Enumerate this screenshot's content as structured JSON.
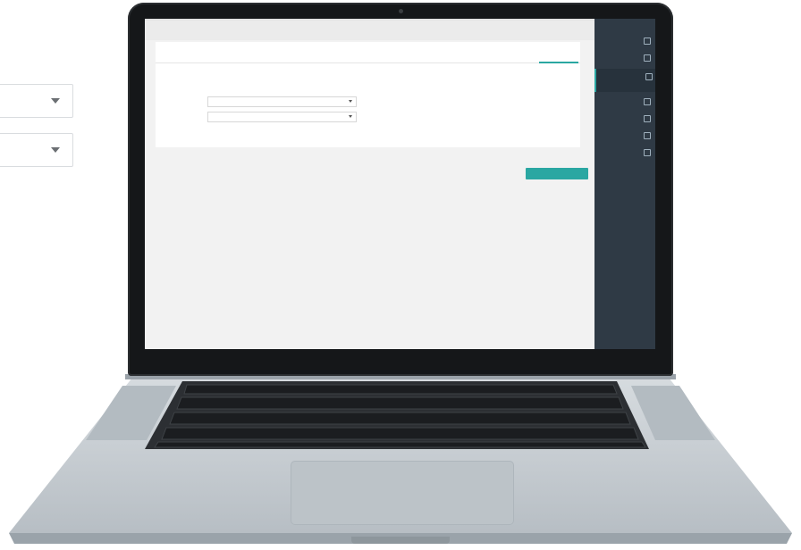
{
  "background_selects": [
    {
      "name": "select-1",
      "value": ""
    },
    {
      "name": "select-2",
      "value": ""
    }
  ],
  "app": {
    "panel_tab": "",
    "description": "",
    "fields": [
      {
        "label": "",
        "value": ""
      },
      {
        "label": "",
        "value": ""
      }
    ],
    "submit_label": ""
  },
  "sidebar": {
    "items": [
      {
        "label": "",
        "icon": "home-icon",
        "active": false
      },
      {
        "label": "",
        "icon": "support-icon",
        "active": false
      },
      {
        "label": "",
        "icon": "document-icon",
        "active": true
      },
      {
        "label": "",
        "icon": "user-icon",
        "active": false
      },
      {
        "label": "",
        "icon": "chart-icon",
        "active": false
      },
      {
        "label": "",
        "icon": "dashboard-icon",
        "active": false
      },
      {
        "label": "",
        "icon": "list-icon",
        "active": false
      }
    ]
  },
  "colors": {
    "accent": "#2aa7a2",
    "sidebar": "#2f3a45",
    "screen_bg": "#f2f2f2"
  }
}
